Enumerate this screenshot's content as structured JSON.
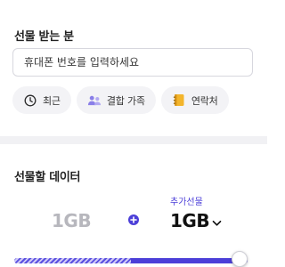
{
  "recipient": {
    "title": "선물 받는 분",
    "phone_placeholder": "휴대폰 번호를 입력하세요",
    "chips": [
      {
        "label": "최근",
        "icon": "clock-icon"
      },
      {
        "label": "결합 가족",
        "icon": "family-icon"
      },
      {
        "label": "연락처",
        "icon": "contact-book-icon"
      }
    ]
  },
  "gift_data": {
    "title": "선물할 데이터",
    "base_amount": "1GB",
    "extra_label": "추가선물",
    "extra_amount": "1GB",
    "slider": {
      "base_fraction": 0.5,
      "value_fraction": 1.0
    }
  },
  "colors": {
    "accent": "#4c3fd8",
    "muted_text": "#b7b7bd",
    "chip_bg": "#f3f3f6",
    "divider": "#f1f1f4"
  }
}
